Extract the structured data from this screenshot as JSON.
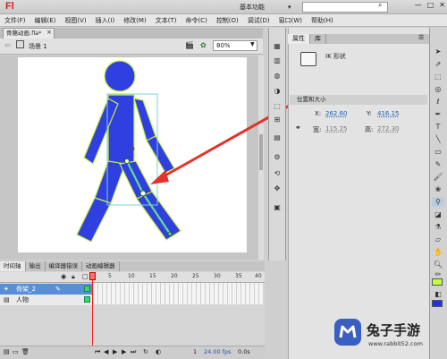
{
  "app": {
    "logo": "Fl",
    "workspace": "基本功能",
    "window_controls": [
      "—",
      "□",
      "✕"
    ]
  },
  "menu": [
    "文件(F)",
    "编辑(E)",
    "视图(V)",
    "插入(I)",
    "修改(M)",
    "文本(T)",
    "命令(C)",
    "控制(O)",
    "调试(D)",
    "窗口(W)",
    "帮助(H)"
  ],
  "document": {
    "tab_title": "骨骼动画.fla*",
    "scene": "场景 1",
    "zoom": "80%"
  },
  "timeline": {
    "tabs": [
      "时间轴",
      "输出",
      "编译器错误",
      "动画编辑器"
    ],
    "frame_numbers": [
      "5",
      "10",
      "15",
      "20",
      "25",
      "30",
      "35",
      "40"
    ],
    "layers": [
      {
        "name": "骨架_2",
        "selected": true
      },
      {
        "name": "人物",
        "selected": false
      }
    ],
    "current_frame": "1",
    "fps": "24.00 fps",
    "time": "0.0s"
  },
  "properties": {
    "tabs": [
      "属性",
      "库"
    ],
    "object_type": "IK 形状",
    "section_title": "位置和大小",
    "x_label": "X:",
    "x_value": "262.60",
    "y_label": "Y:",
    "y_value": "416.15",
    "w_label": "宽:",
    "w_value": "115.25",
    "h_label": "高:",
    "h_value": "272.30"
  },
  "colors": {
    "figure_fill": "#2f3fe0",
    "figure_stroke": "#c8f040",
    "bone": "#66e08a",
    "bbox": "#7fd2dc",
    "arrow": "#e2342a"
  },
  "watermark": {
    "title": "兔子手游",
    "url": "www.rabbit52.com"
  }
}
